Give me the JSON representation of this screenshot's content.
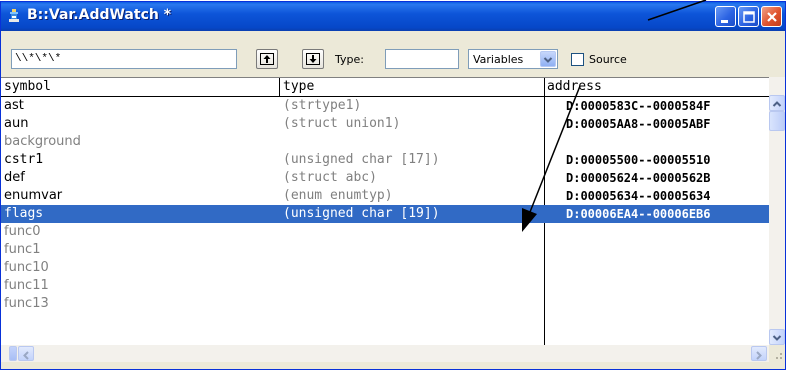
{
  "window": {
    "title": "B::Var.AddWatch *"
  },
  "toolbar": {
    "filter_value": "\\\\*\\*\\*",
    "type_label": "Type:",
    "type_value": "",
    "scope_select": "Variables",
    "source_label": "Source",
    "source_checked": false
  },
  "columns": {
    "symbol": "symbol",
    "type": "type",
    "address": "address"
  },
  "rows": [
    {
      "symbol": "ast",
      "type": "(strtype1)",
      "address": "D:0000583C--0000584F",
      "state": "normal"
    },
    {
      "symbol": "aun",
      "type": "(struct union1)",
      "address": "D:00005AA8--00005ABF",
      "state": "normal"
    },
    {
      "symbol": "background",
      "type": "",
      "address": "",
      "state": "grey"
    },
    {
      "symbol": "cstr1",
      "type": "(unsigned char [17])",
      "address": "D:00005500--00005510",
      "state": "normal"
    },
    {
      "symbol": "def",
      "type": "(struct abc)",
      "address": "D:00005624--0000562B",
      "state": "normal"
    },
    {
      "symbol": "enumvar",
      "type": "(enum enumtyp)",
      "address": "D:00005634--00005634",
      "state": "normal"
    },
    {
      "symbol": "flags",
      "type": "(unsigned char [19])",
      "address": "D:00006EA4--00006EB6",
      "state": "selected"
    },
    {
      "symbol": "func0",
      "type": "",
      "address": "",
      "state": "grey"
    },
    {
      "symbol": "func1",
      "type": "",
      "address": "",
      "state": "grey"
    },
    {
      "symbol": "func10",
      "type": "",
      "address": "",
      "state": "grey"
    },
    {
      "symbol": "func11",
      "type": "",
      "address": "",
      "state": "grey"
    },
    {
      "symbol": "func13",
      "type": "",
      "address": "",
      "state": "grey"
    }
  ],
  "colors": {
    "selection": "#316ac5",
    "titlebar": "#0a5fe6",
    "dim_text": "#808080"
  },
  "icons": {
    "app": "trace32-app-icon",
    "minimize": "minimize-icon",
    "maximize": "maximize-icon",
    "close": "close-icon",
    "up": "scroll-up-icon",
    "down": "scroll-down-icon"
  }
}
